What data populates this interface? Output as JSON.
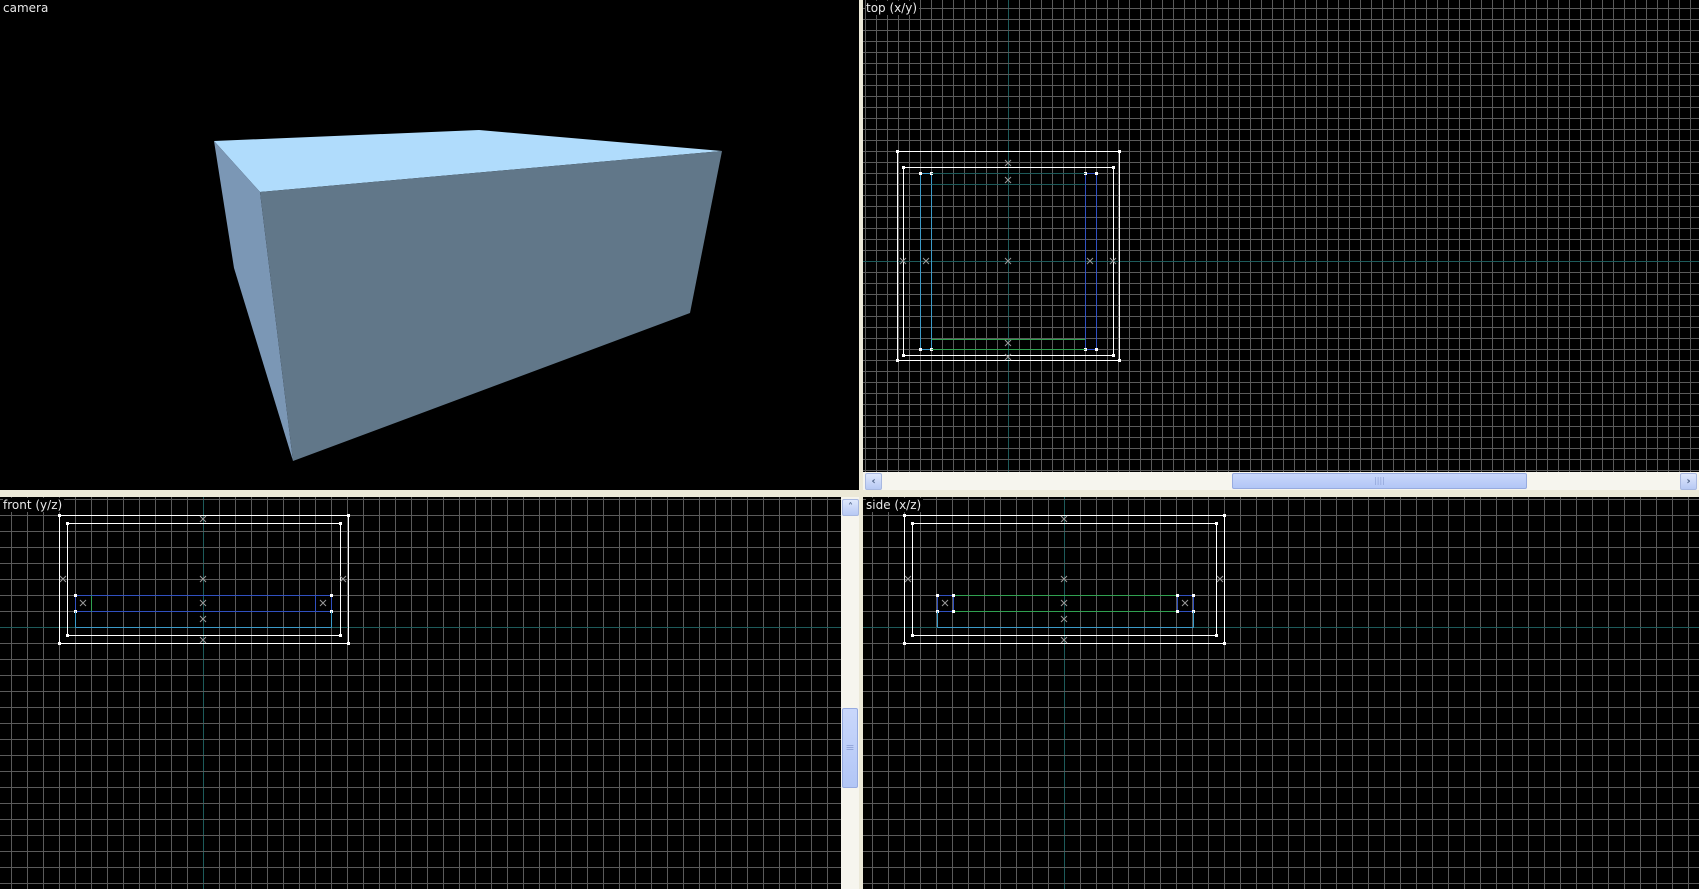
{
  "viewports": {
    "camera": {
      "label": "camera"
    },
    "top": {
      "label": "top (x/y)"
    },
    "front": {
      "label": "front (y/z)"
    },
    "side": {
      "label": "side (x/z)"
    }
  },
  "scrollbars": {
    "top_h": {
      "left_arrow": "‹",
      "right_arrow": "›",
      "grip": "||||",
      "position": 0.46,
      "visible_fraction": 0.35
    },
    "front_v": {
      "up_arrow": "˄",
      "grip": "≡",
      "position": 0.6,
      "visible_fraction": 0.2
    }
  },
  "colors": {
    "grid": "#5a5a5a",
    "axis": "#1d5a5a",
    "brush_outer": "#ffffff",
    "brush_blue": "#3050c0",
    "brush_cyan": "#3a9ac8",
    "brush_green": "#30a050",
    "box_top": "#b0dcfc",
    "box_left": "#7b97b5",
    "box_front": "#617789"
  }
}
